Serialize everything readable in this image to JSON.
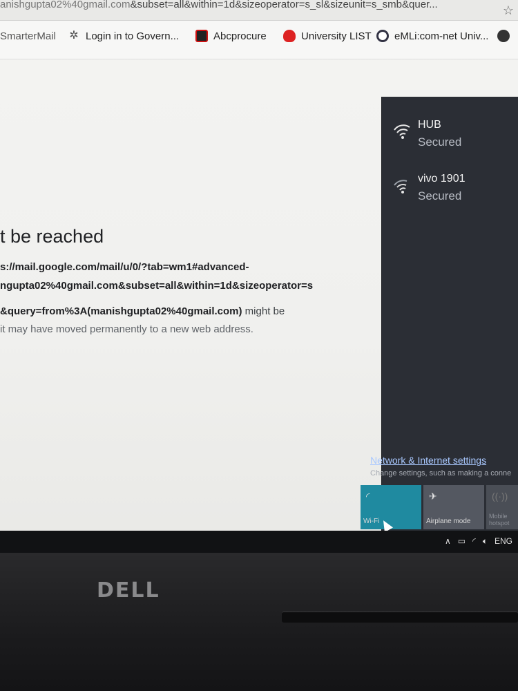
{
  "browser": {
    "address": {
      "prefix": "anishgupta02%40gmail.com",
      "query": "&subset=all&within=1d&sizeoperator=s_sl&sizeunit=s_smb&quer..."
    },
    "bookmarks": [
      {
        "label": "SmarterMail"
      },
      {
        "label": "Login in to Govern..."
      },
      {
        "label": "Abcprocure"
      },
      {
        "label": "University LIST"
      },
      {
        "label": "eMLi:com-net Univ..."
      }
    ]
  },
  "error_page": {
    "title": "t be reached",
    "line1": "s://mail.google.com/mail/u/0/?tab=wm1#advanced-",
    "line2": "ngupta02%40gmail.com&subset=all&within=1d&sizeoperator=s",
    "line3_bold": "&query=from%3A(manishgupta02%40gmail.com)",
    "line3_rest": " might be",
    "line4": "it may have moved permanently to a new web address."
  },
  "network_flyout": {
    "networks": [
      {
        "name": "HUB",
        "status": "Secured"
      },
      {
        "name": "vivo 1901",
        "status": "Secured"
      }
    ],
    "settings_link": "Network & Internet settings",
    "settings_sub": "Change settings, such as making a conne",
    "tiles": {
      "wifi": "Wi-Fi",
      "airplane": "Airplane mode",
      "hotspot_line1": "Mobile",
      "hotspot_line2": "hotspot"
    }
  },
  "taskbar": {
    "language": "ENG"
  },
  "hardware": {
    "brand": "DELL"
  },
  "colors": {
    "flyout_bg": "#2b2e35",
    "wifi_tile": "#1f8aa0",
    "link": "#a9c8ff"
  }
}
